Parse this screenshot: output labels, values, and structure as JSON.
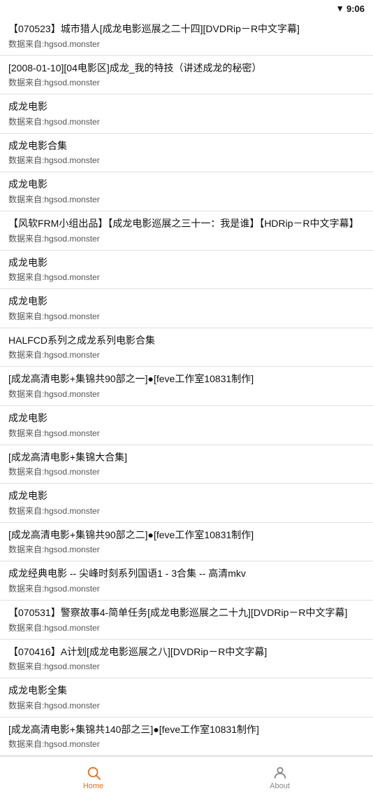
{
  "statusBar": {
    "time": "9:06",
    "wifiIcon": "wifi"
  },
  "items": [
    {
      "title": "【070523】城市猎人[成龙电影巡展之二十四][DVDRip－R中文字幕]",
      "subtitle": "数据来自:hgsod.monster"
    },
    {
      "title": "[2008-01-10][04电影区]成龙_我的特技（讲述成龙的秘密）",
      "subtitle": "数据来自:hgsod.monster"
    },
    {
      "title": "成龙电影",
      "subtitle": "数据来自:hgsod.monster"
    },
    {
      "title": "成龙电影合集",
      "subtitle": "数据来自:hgsod.monster"
    },
    {
      "title": "成龙电影",
      "subtitle": "数据来自:hgsod.monster"
    },
    {
      "title": "【风软FRM小组出品】【成龙电影巡展之三十一：我是谁】【HDRip－R中文字幕】",
      "subtitle": "数据来自:hgsod.monster"
    },
    {
      "title": "成龙电影",
      "subtitle": "数据来自:hgsod.monster"
    },
    {
      "title": "成龙电影",
      "subtitle": "数据来自:hgsod.monster"
    },
    {
      "title": "HALFCD系列之成龙系列电影合集",
      "subtitle": "数据来自:hgsod.monster"
    },
    {
      "title": "[成龙高清电影+集锦共90部之一]●[feve工作室10831制作]",
      "subtitle": "数据来自:hgsod.monster"
    },
    {
      "title": "成龙电影",
      "subtitle": "数据来自:hgsod.monster"
    },
    {
      "title": "[成龙高清电影+集锦大合集]",
      "subtitle": "数据来自:hgsod.monster"
    },
    {
      "title": "成龙电影",
      "subtitle": "数据来自:hgsod.monster"
    },
    {
      "title": "[成龙高清电影+集锦共90部之二]●[feve工作室10831制作]",
      "subtitle": "数据来自:hgsod.monster"
    },
    {
      "title": "成龙经典电影 -- 尖峰时刻系列国语1 - 3合集 -- 高清mkv",
      "subtitle": "数据来自:hgsod.monster"
    },
    {
      "title": "【070531】警察故事4-简单任务[成龙电影巡展之二十九][DVDRip－R中文字幕]",
      "subtitle": "数据来自:hgsod.monster"
    },
    {
      "title": "【070416】A计划[成龙电影巡展之八][DVDRip－R中文字幕]",
      "subtitle": "数据来自:hgsod.monster"
    },
    {
      "title": "成龙电影全集",
      "subtitle": "数据来自:hgsod.monster"
    },
    {
      "title": "[成龙高清电影+集锦共140部之三]●[feve工作室10831制作]",
      "subtitle": "数据来自:hgsod.monster"
    }
  ],
  "bottomNav": {
    "home": {
      "label": "Home",
      "active": true
    },
    "about": {
      "label": "About",
      "active": false
    }
  }
}
